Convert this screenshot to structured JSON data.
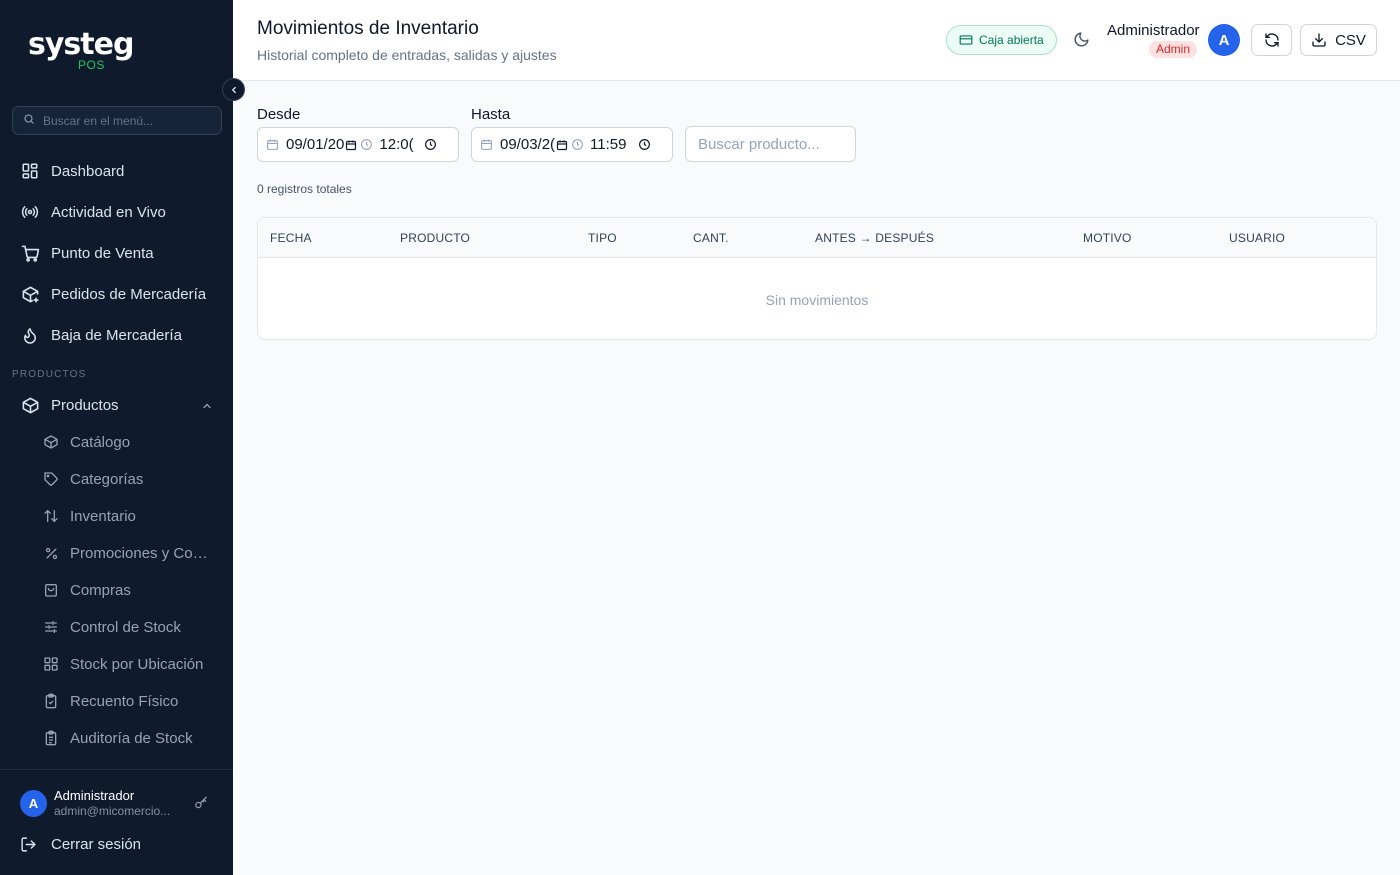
{
  "brand": {
    "name": "systeg",
    "product": "POS",
    "accent": "#22c55e"
  },
  "sidebar": {
    "search_placeholder": "Buscar en el menú...",
    "items": [
      {
        "label": "Dashboard",
        "icon": "dashboard-icon"
      },
      {
        "label": "Actividad en Vivo",
        "icon": "broadcast-icon"
      },
      {
        "label": "Punto de Venta",
        "icon": "cart-icon"
      },
      {
        "label": "Pedidos de Mercadería",
        "icon": "package-plus-icon"
      },
      {
        "label": "Baja de Mercadería",
        "icon": "flame-icon"
      }
    ],
    "section_label": "PRODUCTOS",
    "group": {
      "label": "Productos",
      "icon": "box-icon",
      "expanded": true
    },
    "sub_items": [
      {
        "label": "Catálogo",
        "icon": "box-icon"
      },
      {
        "label": "Categorías",
        "icon": "tag-icon"
      },
      {
        "label": "Inventario",
        "icon": "arrows-updown-icon"
      },
      {
        "label": "Promociones y Com...",
        "icon": "percent-icon"
      },
      {
        "label": "Compras",
        "icon": "shopping-bag-icon"
      },
      {
        "label": "Control de Stock",
        "icon": "sliders-icon"
      },
      {
        "label": "Stock por Ubicación",
        "icon": "grid-icon"
      },
      {
        "label": "Recuento Físico",
        "icon": "clipboard-check-icon"
      },
      {
        "label": "Auditoría de Stock",
        "icon": "clipboard-list-icon"
      }
    ],
    "user": {
      "initial": "A",
      "name": "Administrador",
      "email": "admin@micomercio..."
    },
    "logout_label": "Cerrar sesión"
  },
  "header": {
    "title": "Movimientos de Inventario",
    "subtitle": "Historial completo de entradas, salidas y ajustes",
    "caja_status": "Caja abierta",
    "user_name": "Administrador",
    "role": "Admin",
    "avatar_initial": "A",
    "csv_label": "CSV"
  },
  "filters": {
    "from_label": "Desde",
    "from_date": "09/01/20",
    "from_time": "12:0(",
    "to_label": "Hasta",
    "to_date": "09/03/2(",
    "to_time": "11:59",
    "product_search_placeholder": "Buscar producto..."
  },
  "records_count_text": "0 registros totales",
  "table": {
    "columns": [
      "FECHA",
      "PRODUCTO",
      "TIPO",
      "CANT.",
      "ANTES → DESPUÉS",
      "MOTIVO",
      "USUARIO"
    ],
    "rows": [],
    "empty_text": "Sin movimientos"
  }
}
